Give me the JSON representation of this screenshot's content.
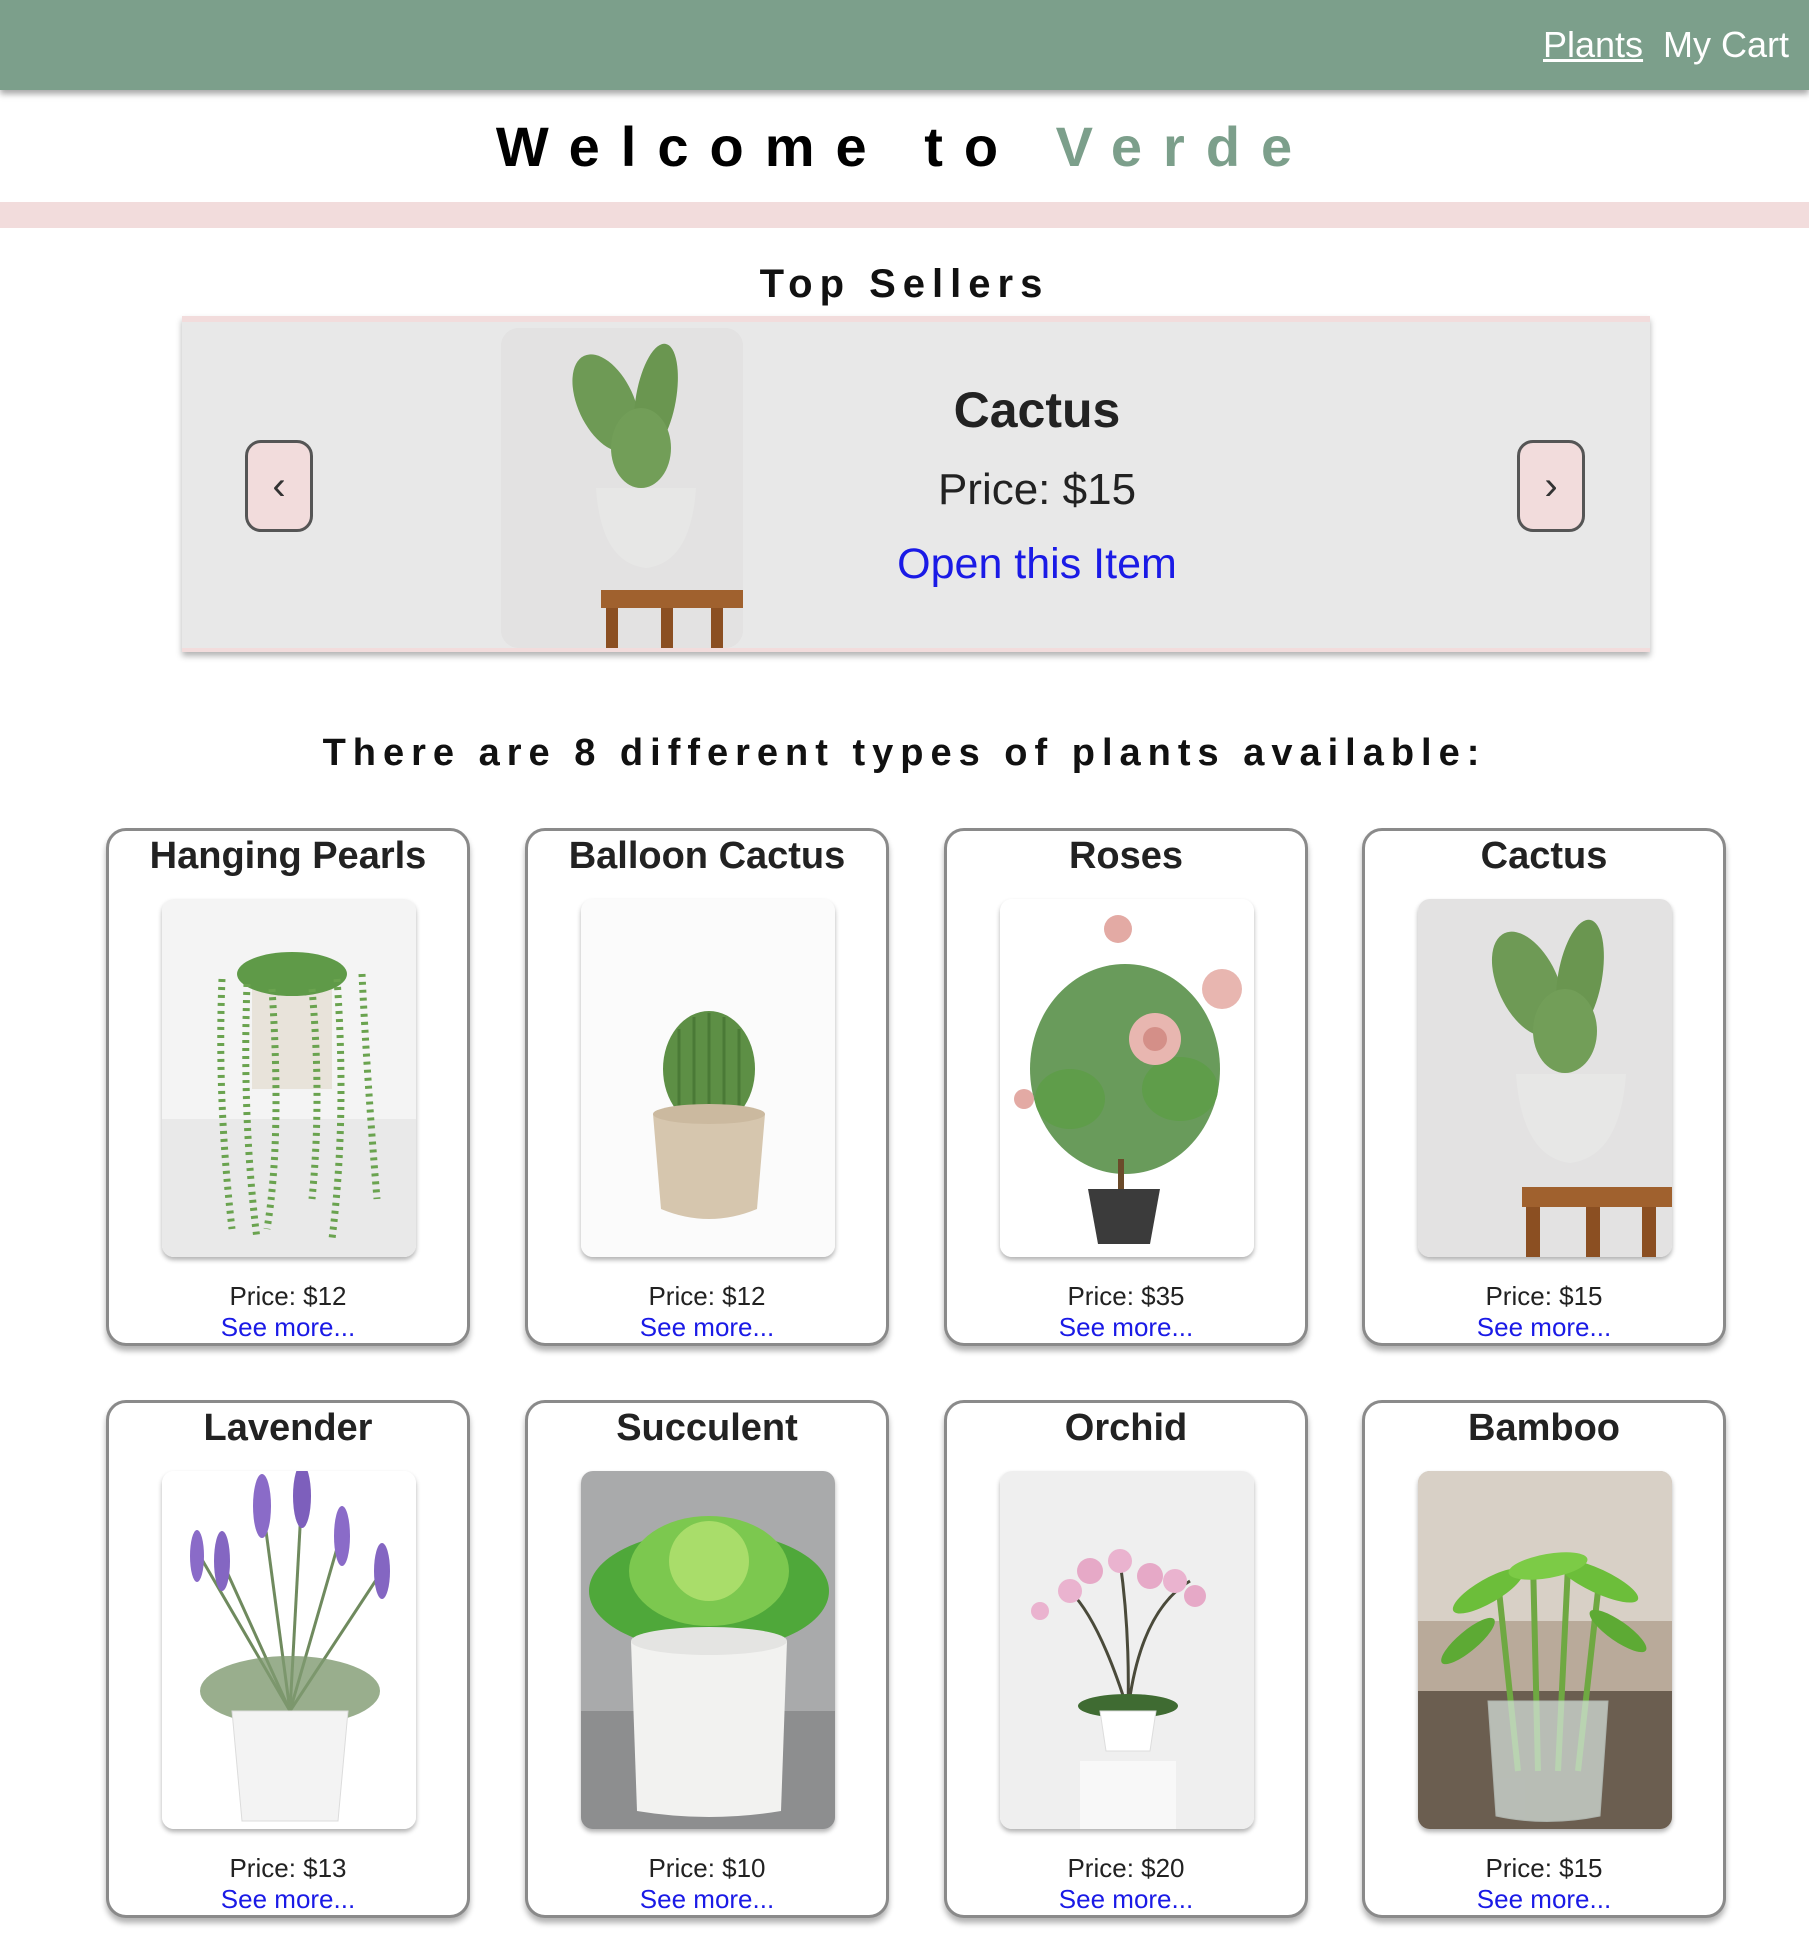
{
  "nav": {
    "plants_label": "Plants",
    "cart_label": "My Cart"
  },
  "header": {
    "welcome_prefix": "Welcome to ",
    "brand_name": "Verde"
  },
  "top_sellers": {
    "title": "Top Sellers",
    "prev_label": "‹",
    "next_label": "›",
    "item_name": "Cactus",
    "item_price": "Price: $15",
    "open_link": "Open this Item"
  },
  "catalog": {
    "count_text": "There are 8 different types of plants available:",
    "plants": [
      {
        "name": "Hanging Pearls",
        "price": "Price: $12",
        "more": "See more..."
      },
      {
        "name": "Balloon Cactus",
        "price": "Price: $12",
        "more": "See more..."
      },
      {
        "name": "Roses",
        "price": "Price: $35",
        "more": "See more..."
      },
      {
        "name": "Cactus",
        "price": "Price: $15",
        "more": "See more..."
      },
      {
        "name": "Lavender",
        "price": "Price: $13",
        "more": "See more..."
      },
      {
        "name": "Succulent",
        "price": "Price: $10",
        "more": "See more..."
      },
      {
        "name": "Orchid",
        "price": "Price: $20",
        "more": "See more..."
      },
      {
        "name": "Bamboo",
        "price": "Price: $15",
        "more": "See more..."
      }
    ]
  },
  "colors": {
    "navbar": "#7c9f8b",
    "brand": "#7c9f8b",
    "accent_pink": "#f2dcdc",
    "link": "#1a1ae6"
  }
}
